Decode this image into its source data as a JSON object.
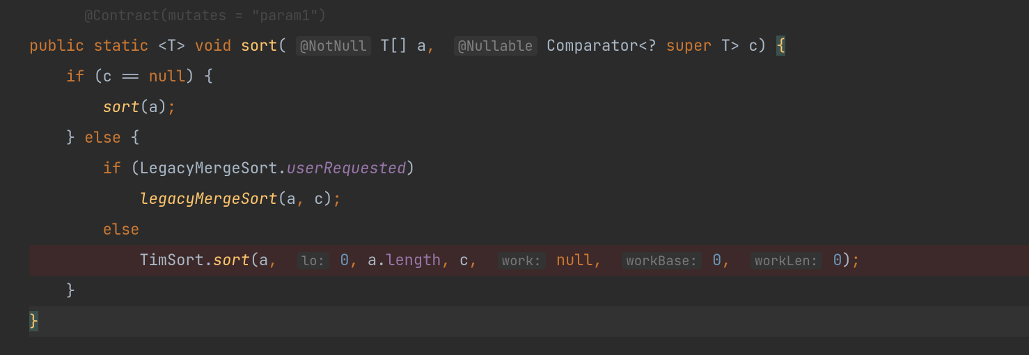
{
  "line0": {
    "contract": "@Contract",
    "mutates": "(mutates = \"param1\")"
  },
  "sig": {
    "public": "public",
    "static": "static",
    "lt": "<",
    "T": "T",
    "gt": ">",
    "void": "void",
    "sort": "sort",
    "lparen": "(",
    "notnull": "@NotNull",
    "Tarr": "T[] ",
    "a": "a",
    "comma1": ",",
    "nullable": "@Nullable",
    "Comparator": "Comparator",
    "lt2": "<",
    "q": "?",
    "super": "super",
    "T2": "T",
    "gt2": ">",
    "c": "c",
    "rparen": ")",
    "lbrace": "{"
  },
  "l2": {
    "if": "if",
    "lparen": "(",
    "c": "c",
    "eq": "==",
    "null": "null",
    "rparen": ")",
    "lbrace": "{"
  },
  "l3": {
    "sort": "sort",
    "lparen": "(",
    "a": "a",
    "rparen": ")",
    "semi": ";"
  },
  "l4": {
    "rbrace": "}",
    "else": "else",
    "lbrace": "{"
  },
  "l5": {
    "if": "if",
    "lparen": "(",
    "LegacyMergeSort": "LegacyMergeSort",
    "dot": ".",
    "userRequested": "userRequested",
    "rparen": ")"
  },
  "l6": {
    "legacyMergeSort": "legacyMergeSort",
    "lparen": "(",
    "a": "a",
    "comma": ",",
    "c": "c",
    "rparen": ")",
    "semi": ";"
  },
  "l7": {
    "else": "else"
  },
  "l8": {
    "TimSort": "TimSort",
    "dot": ".",
    "sort": "sort",
    "lparen": "(",
    "a": "a",
    "c1": ",",
    "hint_lo": "lo:",
    "zero1": "0",
    "c2": ",",
    "a2": "a",
    "dot2": ".",
    "length": "length",
    "c3": ",",
    "cc": "c",
    "c4": ",",
    "hint_work": "work:",
    "null": "null",
    "c5": ",",
    "hint_workBase": "workBase:",
    "zero2": "0",
    "c6": ",",
    "hint_workLen": "workLen:",
    "zero3": "0",
    "rparen": ")",
    "semi": ";"
  },
  "l9": {
    "rbrace": "}"
  },
  "l10": {
    "rbrace": "}"
  }
}
